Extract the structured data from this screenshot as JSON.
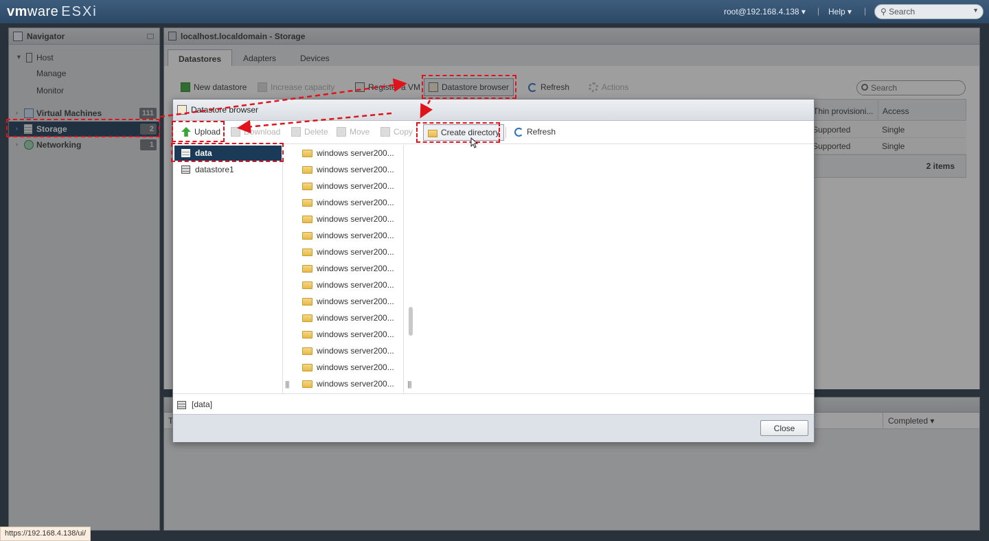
{
  "topbar": {
    "brand_vm": "vm",
    "brand_ware": "ware",
    "brand_esxi": "ESXi",
    "user": "root@192.168.4.138 ▾",
    "help": "Help ▾",
    "search_placeholder": "Search"
  },
  "navigator": {
    "title": "Navigator",
    "host": "Host",
    "manage": "Manage",
    "monitor": "Monitor",
    "vms": "Virtual Machines",
    "vms_count": "111",
    "storage": "Storage",
    "storage_count": "2",
    "networking": "Networking",
    "networking_count": "1"
  },
  "main": {
    "title": "localhost.localdomain - Storage",
    "tabs": [
      "Datastores",
      "Adapters",
      "Devices"
    ],
    "toolbar": {
      "new_datastore": "New datastore",
      "increase_capacity": "Increase capacity",
      "register_vm": "Register a VM",
      "datastore_browser": "Datastore browser",
      "refresh": "Refresh",
      "actions": "Actions"
    },
    "search_placeholder": "Search",
    "table": {
      "col_thin": "Thin provisioni...",
      "col_access": "Access",
      "rows": [
        {
          "thin": "Supported",
          "access": "Single"
        },
        {
          "thin": "Supported",
          "access": "Single"
        }
      ],
      "count": "2 items"
    }
  },
  "tasks": {
    "col_t": "T",
    "completed": "Completed ▾"
  },
  "dialog": {
    "title": "Datastore browser",
    "toolbar": {
      "upload": "Upload",
      "download": "Download",
      "delete": "Delete",
      "move": "Move",
      "copy": "Copy",
      "create_directory": "Create directory",
      "refresh": "Refresh"
    },
    "datastores": [
      "data",
      "datastore1"
    ],
    "folders": [
      "windows server200...",
      "windows server200...",
      "windows server200...",
      "windows server200...",
      "windows server200...",
      "windows server200...",
      "windows server200...",
      "windows server200...",
      "windows server200...",
      "windows server200...",
      "windows server200...",
      "windows server200...",
      "windows server200...",
      "windows server200...",
      "windows server200..."
    ],
    "path": "[data]",
    "close": "Close"
  },
  "status_url": "https://192.168.4.138/ui/",
  "colors": {
    "annotation_red": "#e0121b",
    "selected_nav": "#1b3a57",
    "topbar": "#2c4866"
  }
}
